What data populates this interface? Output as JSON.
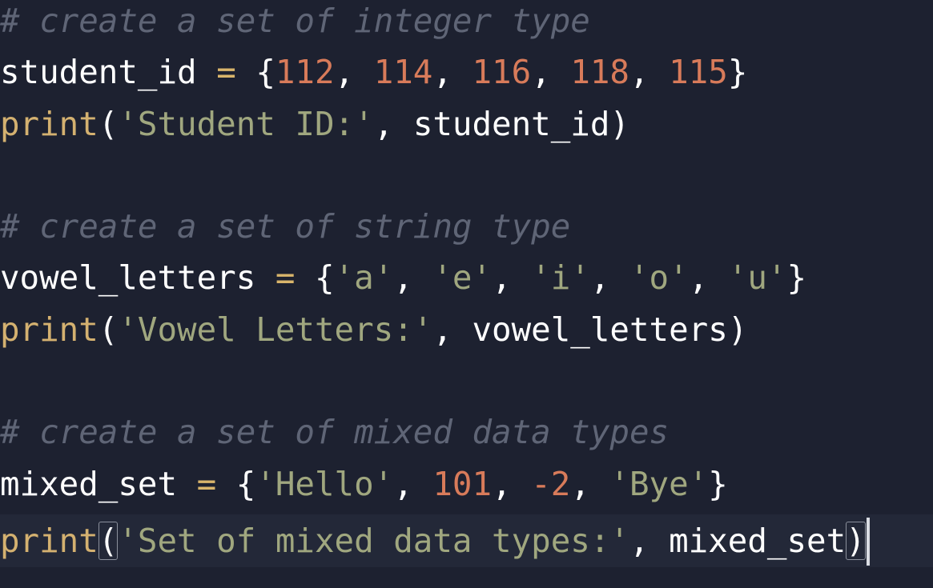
{
  "colors": {
    "background": "#1d2130",
    "current_line": "#232838",
    "comment": "#5f6576",
    "identifier": "#ffffff",
    "operator": "#d9b56b",
    "number": "#d87b5a",
    "string": "#a0a77f",
    "function": "#d4b170"
  },
  "code": {
    "line1": {
      "comment": "# create a set of integer type"
    },
    "line2": {
      "var": "student_id",
      "op": "=",
      "open": "{",
      "n1": "112",
      "n2": "114",
      "n3": "116",
      "n4": "118",
      "n5": "115",
      "close": "}"
    },
    "line3": {
      "fn": "print",
      "arg_str": "'Student ID:'",
      "arg_var": "student_id"
    },
    "line5": {
      "comment": "# create a set of string type"
    },
    "line6": {
      "var": "vowel_letters",
      "op": "=",
      "s1": "'a'",
      "s2": "'e'",
      "s3": "'i'",
      "s4": "'o'",
      "s5": "'u'"
    },
    "line7": {
      "fn": "print",
      "arg_str": "'Vowel Letters:'",
      "arg_var": "vowel_letters"
    },
    "line9": {
      "comment": "# create a set of mixed data types"
    },
    "line10": {
      "var": "mixed_set",
      "op": "=",
      "s1": "'Hello'",
      "n1": "101",
      "n2": "-2",
      "s2": "'Bye'"
    },
    "line11": {
      "fn": "print",
      "arg_str": "'Set of mixed data types:'",
      "arg_var": "mixed_set"
    }
  }
}
